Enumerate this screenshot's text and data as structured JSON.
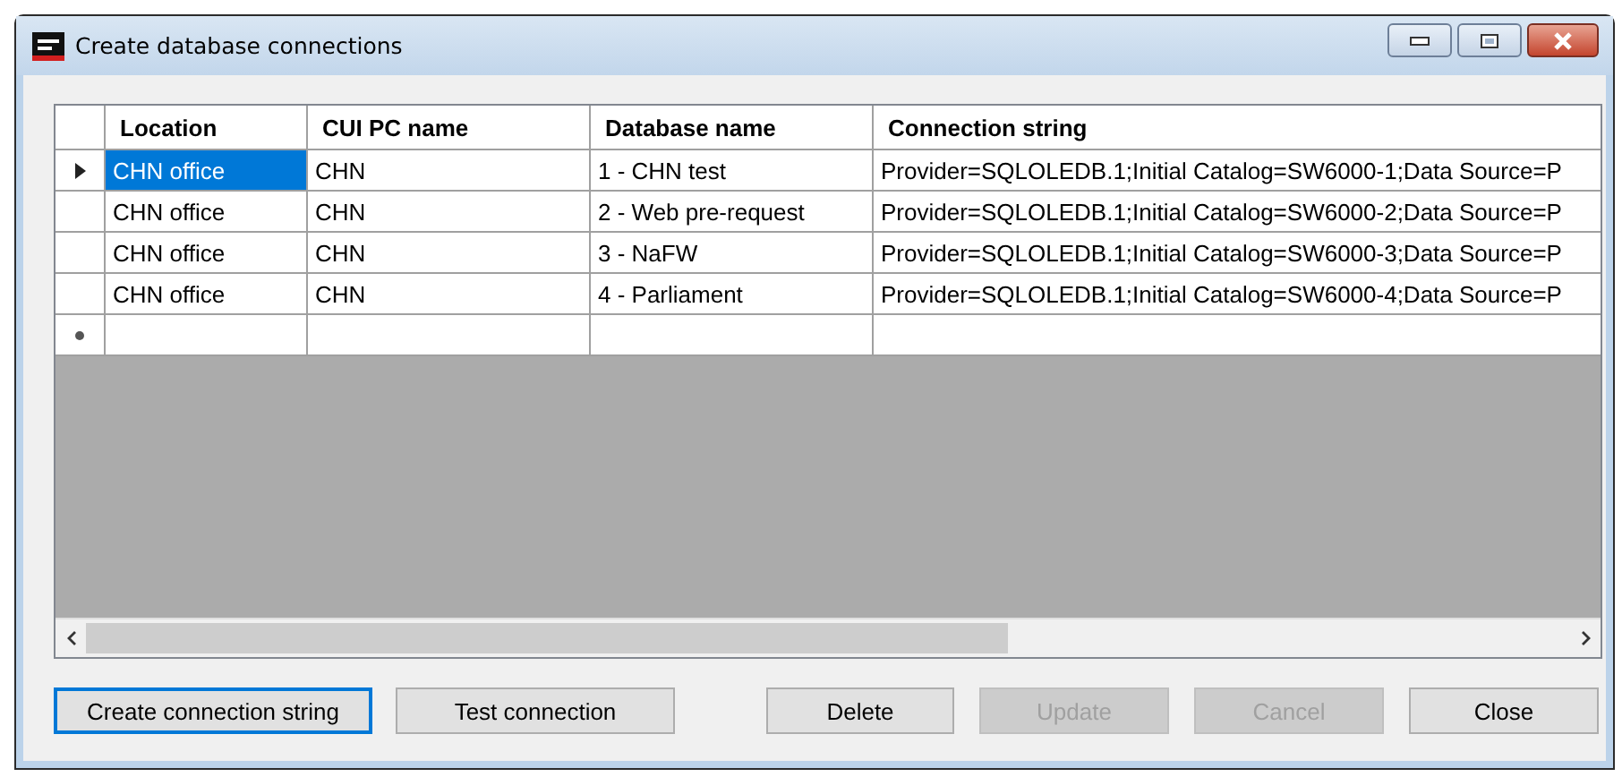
{
  "window": {
    "title": "Create database connections",
    "controls": [
      {
        "kind": "minimize"
      },
      {
        "kind": "maximize"
      },
      {
        "kind": "close"
      }
    ]
  },
  "grid": {
    "columns": [
      "Location",
      "CUI PC name",
      "Database name",
      "Connection string"
    ],
    "rows": [
      {
        "current": true,
        "cells": [
          {
            "text": "CHN office",
            "selected": true
          },
          {
            "text": "CHN",
            "selected": false
          },
          {
            "text": "1 - CHN test",
            "selected": false
          },
          {
            "text": "Provider=SQLOLEDB.1;Initial Catalog=SW6000-1;Data Source=P",
            "selected": false
          }
        ]
      },
      {
        "current": false,
        "cells": [
          {
            "text": "CHN office",
            "selected": false
          },
          {
            "text": "CHN",
            "selected": false
          },
          {
            "text": "2 - Web pre-request",
            "selected": false
          },
          {
            "text": "Provider=SQLOLEDB.1;Initial Catalog=SW6000-2;Data Source=P",
            "selected": false
          }
        ]
      },
      {
        "current": false,
        "cells": [
          {
            "text": "CHN office",
            "selected": false
          },
          {
            "text": "CHN",
            "selected": false
          },
          {
            "text": "3 - NaFW",
            "selected": false
          },
          {
            "text": "Provider=SQLOLEDB.1;Initial Catalog=SW6000-3;Data Source=P",
            "selected": false
          }
        ]
      },
      {
        "current": false,
        "cells": [
          {
            "text": "CHN office",
            "selected": false
          },
          {
            "text": "CHN",
            "selected": false
          },
          {
            "text": "4 - Parliament",
            "selected": false
          },
          {
            "text": "Provider=SQLOLEDB.1;Initial Catalog=SW6000-4;Data Source=P",
            "selected": false
          }
        ]
      }
    ],
    "new_row": true
  },
  "buttons": [
    {
      "label": "Create connection string",
      "disabled": false,
      "default": true
    },
    {
      "label": "Test connection",
      "disabled": false,
      "default": false
    },
    {
      "label": "Delete",
      "disabled": false,
      "default": false
    },
    {
      "label": "Update",
      "disabled": true,
      "default": false
    },
    {
      "label": "Cancel",
      "disabled": true,
      "default": false
    },
    {
      "label": "Close",
      "disabled": false,
      "default": false
    }
  ]
}
